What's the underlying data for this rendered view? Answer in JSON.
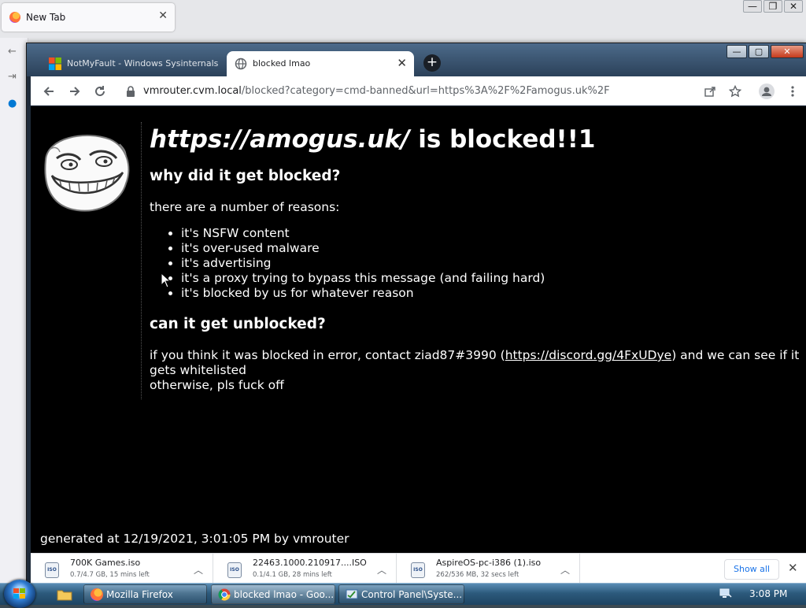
{
  "background_window": {
    "tab_title": "New Tab",
    "caption_buttons": [
      "—",
      "❐",
      "✕"
    ]
  },
  "chrome": {
    "tabs": [
      {
        "title": "NotMyFault - Windows Sysinternals",
        "active": false
      },
      {
        "title": "blocked lmao",
        "active": true
      }
    ],
    "new_tab_label": "+",
    "url": {
      "host": "vmrouter.cvm.local",
      "path": "/blocked?category=cmd-banned&url=https%3A%2F%2Famogus.uk%2F"
    },
    "caption_buttons": [
      "—",
      "▢",
      "✕"
    ]
  },
  "page": {
    "heading_url": "https://amogus.uk/",
    "heading_suffix": " is blocked!!1",
    "why_heading": "why did it get blocked?",
    "reasons_intro": "there are a number of reasons:",
    "reasons": [
      "it's NSFW content",
      "it's over-used malware",
      "it's advertising",
      "it's a proxy trying to bypass this message (and failing hard)",
      "it's blocked by us for whatever reason"
    ],
    "unblock_heading": "can it get unblocked?",
    "unblock_text_1": "if you think it was blocked in error, contact ziad87#3990 (",
    "discord_link": "https://discord.gg/4FxUDye",
    "unblock_text_2": ") and we can see if it gets whitelisted",
    "unblock_text_3": "otherwise, pls fuck off",
    "footer": "generated at 12/19/2021, 3:01:05 PM by vmrouter"
  },
  "downloads": {
    "items": [
      {
        "name": "700K Games.iso",
        "status": "0.7/4.7 GB, 15 mins left"
      },
      {
        "name": "22463.1000.210917....ISO",
        "status": "0.1/4.1 GB, 28 mins left"
      },
      {
        "name": "AspireOS-pc-i386 (1).iso",
        "status": "262/536 MB, 32 secs left"
      }
    ],
    "icon_label": "ISO",
    "show_all": "Show all"
  },
  "taskbar": {
    "items": [
      {
        "label": "Mozilla Firefox"
      },
      {
        "label": "blocked lmao - Goo..."
      },
      {
        "label": "Control Panel\\Syste..."
      }
    ],
    "clock": "3:08 PM"
  },
  "colors": {
    "page_background": "#000000",
    "page_text": "#ffffff",
    "link_blue": "#1a73e8",
    "taskbar": "#2c5a7c"
  }
}
